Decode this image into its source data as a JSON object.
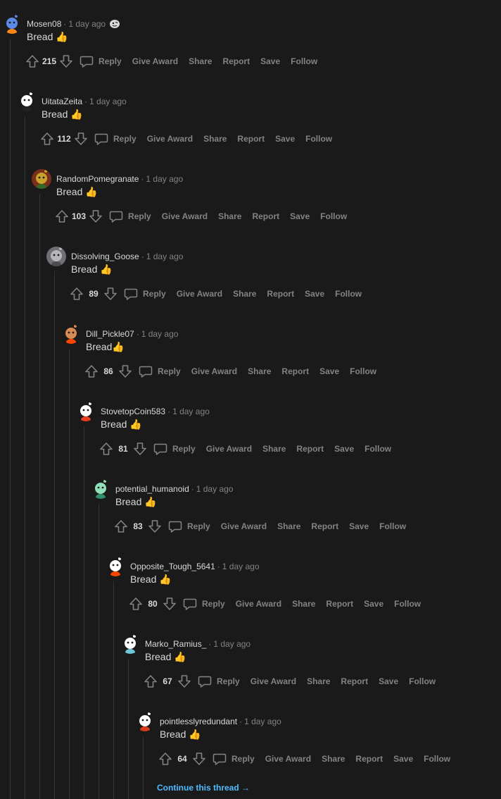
{
  "comments": [
    {
      "author": "Mosen08",
      "time": "1 day ago",
      "body": "Bread 👍",
      "score": "215",
      "has_flair": true,
      "avatar": {
        "bg": "#1a1a1b",
        "face": "#5c8ae8",
        "accent": "#ff8717"
      }
    },
    {
      "author": "UitataZeita",
      "time": "1 day ago",
      "body": "Bread 👍",
      "score": "112",
      "has_flair": false,
      "avatar": {
        "bg": "#1a1a1b",
        "face": "#ffffff",
        "accent": "#222222"
      }
    },
    {
      "author": "RandomPomegranate",
      "time": "1 day ago",
      "body": "Bread 👍",
      "score": "103",
      "has_flair": false,
      "avatar": {
        "bg": "#7a2e1c",
        "face": "#c8a22a",
        "accent": "#2f6b2a"
      }
    },
    {
      "author": "Dissolving_Goose",
      "time": "1 day ago",
      "body": "Bread 👍",
      "score": "89",
      "has_flair": false,
      "avatar": {
        "bg": "#6f7073",
        "face": "#b5b6b8",
        "accent": "#4a4b4d"
      }
    },
    {
      "author": "Dill_Pickle07",
      "time": "1 day ago",
      "body": "Bread👍",
      "score": "86",
      "has_flair": false,
      "avatar": {
        "bg": "#1a1a1b",
        "face": "#d98b52",
        "accent": "#ff4500"
      }
    },
    {
      "author": "StovetopCoin583",
      "time": "1 day ago",
      "body": "Bread 👍",
      "score": "81",
      "has_flair": false,
      "avatar": {
        "bg": "#1a1a1b",
        "face": "#ffffff",
        "accent": "#e8401c"
      }
    },
    {
      "author": "potential_humanoid",
      "time": "1 day ago",
      "body": "Bread 👍",
      "score": "83",
      "has_flair": false,
      "avatar": {
        "bg": "#1a1a1b",
        "face": "#8fe0b8",
        "accent": "#2f8f6a"
      }
    },
    {
      "author": "Opposite_Tough_5641",
      "time": "1 day ago",
      "body": "Bread 👍",
      "score": "80",
      "has_flair": false,
      "avatar": {
        "bg": "#1a1a1b",
        "face": "#ffffff",
        "accent": "#ff4500"
      }
    },
    {
      "author": "Marko_Ramius_",
      "time": "1 day ago",
      "body": "Bread 👍",
      "score": "67",
      "has_flair": false,
      "avatar": {
        "bg": "#1a1a1b",
        "face": "#ffffff",
        "accent": "#6fc6d8"
      }
    },
    {
      "author": "pointlesslyredundant",
      "time": "1 day ago",
      "body": "Bread 👍",
      "score": "64",
      "has_flair": false,
      "avatar": {
        "bg": "#1a1a1b",
        "face": "#ffffff",
        "accent": "#d93a1a"
      }
    }
  ],
  "actions": {
    "reply": "Reply",
    "give_award": "Give Award",
    "share": "Share",
    "report": "Report",
    "save": "Save",
    "follow": "Follow"
  },
  "continue_thread": "Continue this thread →",
  "colors": {
    "background": "#1a1a1b",
    "thread_line": "#343536",
    "text_primary": "#d7dadc",
    "text_muted": "#818384",
    "link": "#4fbcff"
  },
  "icons": [
    "upvote-icon",
    "downvote-icon",
    "comment-icon",
    "flair-icon",
    "chevron-right-icon"
  ]
}
